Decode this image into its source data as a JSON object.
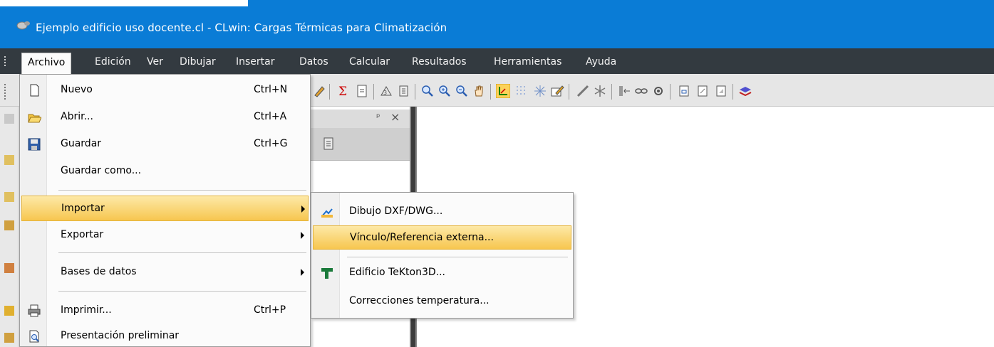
{
  "window": {
    "title": "Ejemplo edificio uso docente.cl - CLwin: Cargas Térmicas para Climatización",
    "title_bar_color": "#0a7cd6"
  },
  "menubar": {
    "items": [
      "Archivo",
      "Edición",
      "Ver",
      "Dibujar",
      "Insertar",
      "Datos",
      "Calcular",
      "Resultados",
      "Herramientas",
      "Ayuda"
    ],
    "active": "Archivo"
  },
  "toolbar": {
    "icons": [
      "sum-icon",
      "import-icon",
      "measure-icon",
      "report-icon",
      "zoom-icon",
      "zoom-in-icon",
      "zoom-out-icon",
      "pan-hand-icon",
      "ortho-icon",
      "grid-icon",
      "snap-icon",
      "edit-icon",
      "ruler-icon",
      "snowflake-icon",
      "link-icon",
      "chain-icon",
      "gear-icon",
      "page-icon",
      "page2-icon",
      "page3-icon",
      "layers-icon"
    ]
  },
  "panel": {
    "pin_glyph": "ᵖ",
    "close_glyph": "×"
  },
  "file_menu": {
    "items": [
      {
        "label": "Nuevo",
        "shortcut": "Ctrl+N",
        "icon": "new-file-icon"
      },
      {
        "label": "Abrir...",
        "shortcut": "Ctrl+A",
        "icon": "open-folder-icon"
      },
      {
        "label": "Guardar",
        "shortcut": "Ctrl+G",
        "icon": "save-disk-icon"
      },
      {
        "label": "Guardar como...",
        "shortcut": ""
      },
      {
        "label": "Importar",
        "submenu": true,
        "highlighted": true
      },
      {
        "label": "Exportar",
        "submenu": true
      },
      {
        "label": "Bases de datos",
        "submenu": true
      },
      {
        "label": "Imprimir...",
        "shortcut": "Ctrl+P",
        "icon": "printer-icon"
      },
      {
        "label": "Presentación preliminar",
        "icon": "print-preview-icon"
      }
    ]
  },
  "import_submenu": {
    "items": [
      {
        "label": "Dibujo DXF/DWG...",
        "icon": "dxf-import-icon"
      },
      {
        "label": "Vínculo/Referencia externa...",
        "highlighted": true
      },
      {
        "label": "Edificio TeKton3D...",
        "icon": "tekton-icon"
      },
      {
        "label": "Correcciones temperatura..."
      }
    ]
  },
  "colors": {
    "menubar_bg": "#333a40",
    "highlight_top": "#fde9a7",
    "highlight_bottom": "#f7c64f"
  }
}
